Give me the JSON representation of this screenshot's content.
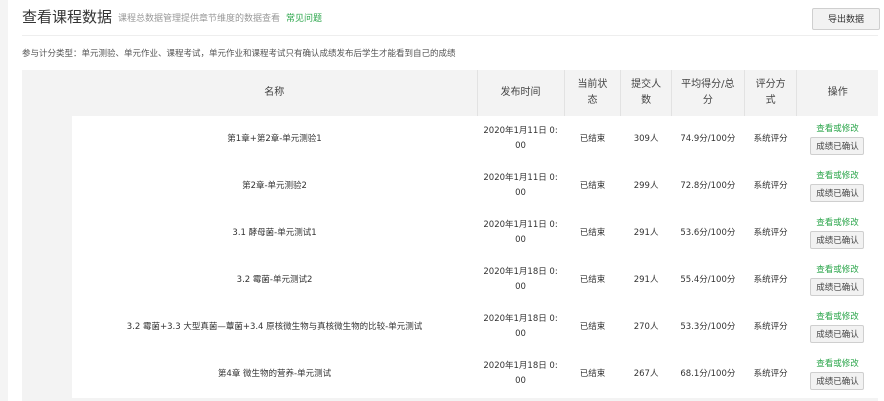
{
  "header": {
    "title": "查看课程数据",
    "subtitle": "课程总数据管理提供章节维度的数据查看",
    "faq_link": "常见问题",
    "export_button": "导出数据"
  },
  "notice": "参与计分类型：单元测验、单元作业、课程考试，单元作业和课程考试只有确认成绩发布后学生才能看到自己的成绩",
  "table": {
    "headers": {
      "name": "名称",
      "publish_time": "发布时间",
      "status": "当前状\n态",
      "submit_count": "提交人\n数",
      "avg_score": "平均得分/总\n分",
      "grading": "评分方\n式",
      "actions": "操作"
    },
    "rows": [
      {
        "name": "第1章+第2章-单元测验1",
        "time": "2020年1月11日 0:\n00",
        "status": "已结束",
        "count": "309人",
        "score": "74.9分/100分",
        "grading": "系统评分",
        "edit": "查看或修改",
        "confirm": "成绩已确认"
      },
      {
        "name": "第2章-单元测验2",
        "time": "2020年1月11日 0:\n00",
        "status": "已结束",
        "count": "299人",
        "score": "72.8分/100分",
        "grading": "系统评分",
        "edit": "查看或修改",
        "confirm": "成绩已确认"
      },
      {
        "name": "3.1 酵母菌-单元测试1",
        "time": "2020年1月11日 0:\n00",
        "status": "已结束",
        "count": "291人",
        "score": "53.6分/100分",
        "grading": "系统评分",
        "edit": "查看或修改",
        "confirm": "成绩已确认"
      },
      {
        "name": "3.2 霉菌-单元测试2",
        "time": "2020年1月18日 0:\n00",
        "status": "已结束",
        "count": "291人",
        "score": "55.4分/100分",
        "grading": "系统评分",
        "edit": "查看或修改",
        "confirm": "成绩已确认"
      },
      {
        "name": "3.2 霉菌+3.3 大型真菌—蕈菌+3.4 原核微生物与真核微生物的比较-单元测试",
        "time": "2020年1月18日 0:\n00",
        "status": "已结束",
        "count": "270人",
        "score": "53.3分/100分",
        "grading": "系统评分",
        "edit": "查看或修改",
        "confirm": "成绩已确认"
      },
      {
        "name": "第4章 微生物的营养-单元测试",
        "time": "2020年1月18日 0:\n00",
        "status": "已结束",
        "count": "267人",
        "score": "68.1分/100分",
        "grading": "系统评分",
        "edit": "查看或修改",
        "confirm": "成绩已确认"
      }
    ]
  }
}
